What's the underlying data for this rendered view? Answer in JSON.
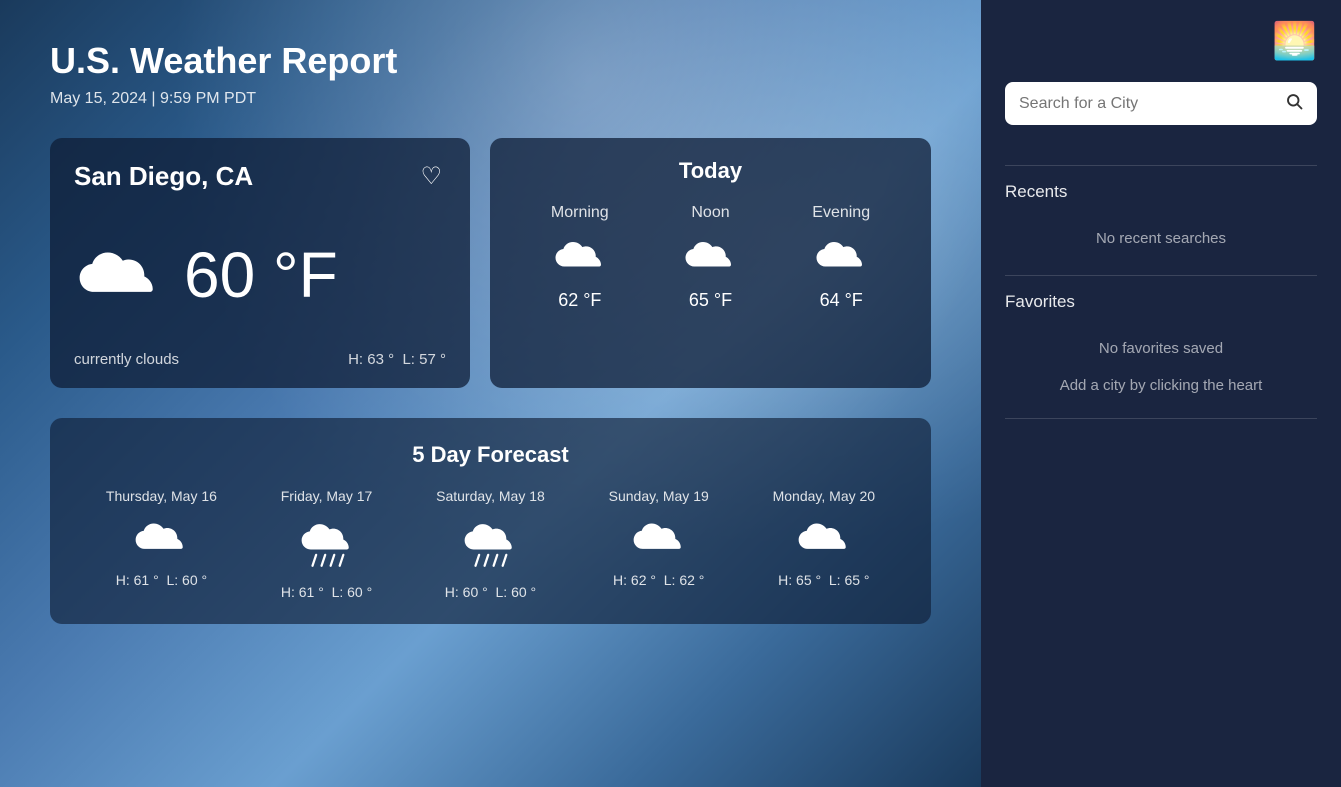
{
  "app": {
    "title": "U.S. Weather Report",
    "datetime": "May 15, 2024 | 9:59 PM PDT"
  },
  "sidebar": {
    "search_placeholder": "Search for a City",
    "recents_label": "Recents",
    "recents_empty": "No recent searches",
    "favorites_label": "Favorites",
    "favorites_empty": "No favorites saved",
    "favorites_hint": "Add a city by clicking the heart"
  },
  "city": {
    "name": "San Diego, CA",
    "temperature": "60 °F",
    "currently": "currently clouds",
    "high": "H: 63 °",
    "low": "L: 57 °"
  },
  "today": {
    "title": "Today",
    "periods": [
      {
        "label": "Morning",
        "temp": "62 °F"
      },
      {
        "label": "Noon",
        "temp": "65 °F"
      },
      {
        "label": "Evening",
        "temp": "64 °F"
      }
    ]
  },
  "forecast": {
    "title": "5 Day Forecast",
    "days": [
      {
        "label": "Thursday, May 16",
        "high": "H: 61 °",
        "low": "L: 60 °",
        "type": "cloud"
      },
      {
        "label": "Friday, May 17",
        "high": "H: 61 °",
        "low": "L: 60 °",
        "type": "rain"
      },
      {
        "label": "Saturday, May 18",
        "high": "H: 60 °",
        "low": "L: 60 °",
        "type": "rain"
      },
      {
        "label": "Sunday, May 19",
        "high": "H: 62 °",
        "low": "L: 62 °",
        "type": "cloud"
      },
      {
        "label": "Monday, May 20",
        "high": "H: 65 °",
        "low": "L: 65 °",
        "type": "cloud"
      }
    ]
  },
  "icons": {
    "heart": "♡",
    "search": "🔍",
    "logo": "🌅"
  }
}
